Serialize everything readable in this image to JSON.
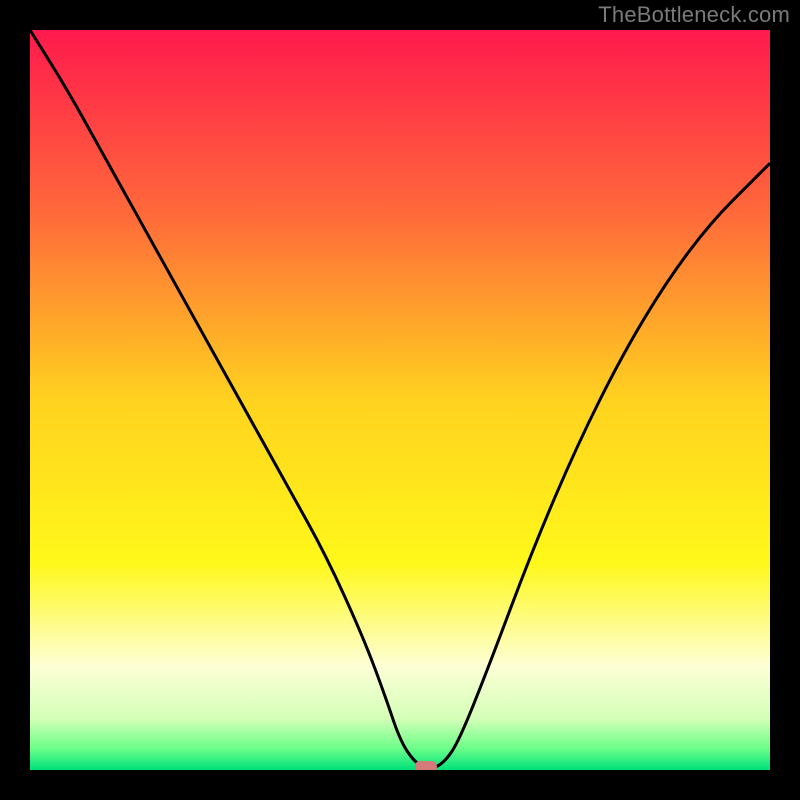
{
  "watermark": "TheBottleneck.com",
  "chart_data": {
    "type": "line",
    "title": "",
    "xlabel": "",
    "ylabel": "",
    "xlim": [
      0,
      100
    ],
    "ylim": [
      0,
      100
    ],
    "legend": false,
    "grid": false,
    "background": {
      "type": "vertical-gradient",
      "stops": [
        {
          "pos": 0.0,
          "color": "#ff1a4d"
        },
        {
          "pos": 0.25,
          "color": "#ff6a3a"
        },
        {
          "pos": 0.5,
          "color": "#ffd21f"
        },
        {
          "pos": 0.72,
          "color": "#fff81a"
        },
        {
          "pos": 0.86,
          "color": "#fdffd6"
        },
        {
          "pos": 0.93,
          "color": "#d4ffb8"
        },
        {
          "pos": 0.97,
          "color": "#6fff8a"
        },
        {
          "pos": 1.0,
          "color": "#00e07a"
        }
      ]
    },
    "marker": {
      "x": 53.5,
      "y": 0,
      "color": "#d47a7a",
      "shape": "rounded-rect"
    },
    "series": [
      {
        "name": "bottleneck-curve",
        "color": "#000000",
        "x": [
          0,
          5,
          10,
          15,
          20,
          25,
          30,
          35,
          40,
          45,
          48,
          50,
          52,
          54,
          56,
          58,
          62,
          68,
          74,
          80,
          86,
          92,
          98,
          100
        ],
        "y": [
          100,
          92,
          83,
          74,
          65,
          56,
          47,
          38,
          29,
          18,
          10,
          4,
          1,
          0,
          1,
          4,
          14,
          30,
          44,
          56,
          66,
          74,
          80,
          82
        ]
      }
    ]
  }
}
